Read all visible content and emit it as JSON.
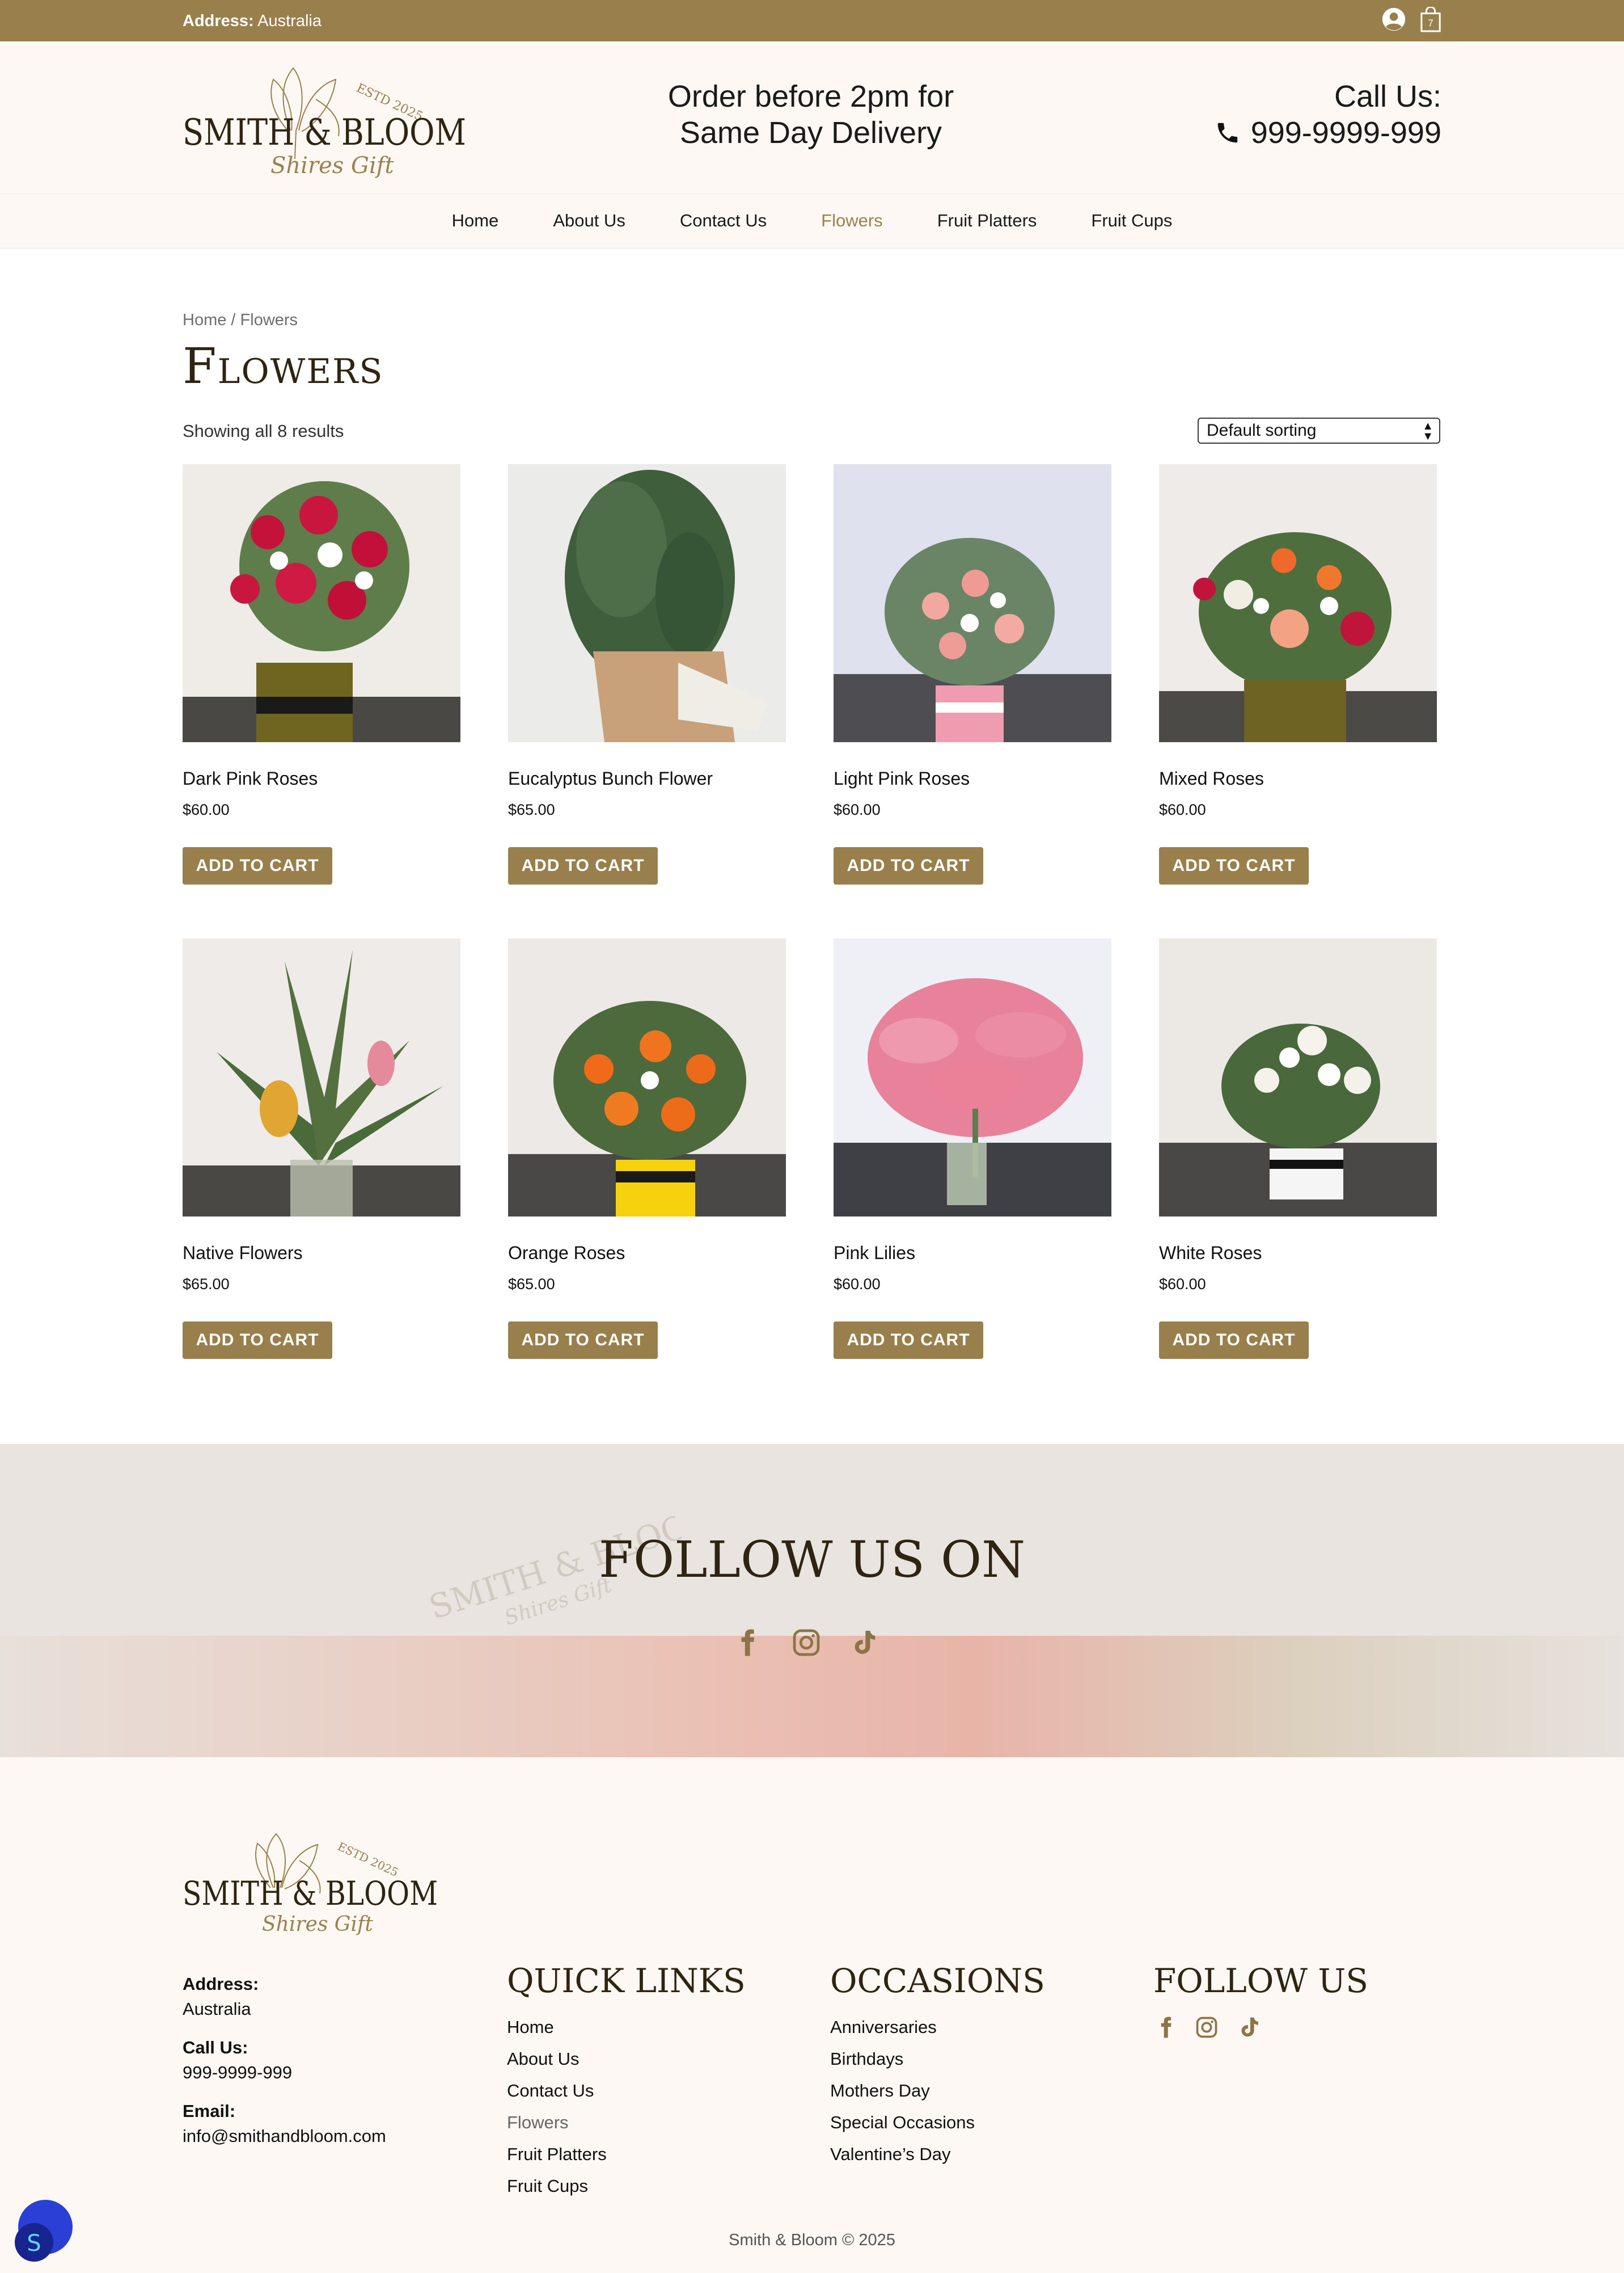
{
  "topbar": {
    "address_label": "Address:",
    "address_value": "Australia",
    "cart_count": "7"
  },
  "header": {
    "logo_brand": "SMITH & BLOOM",
    "logo_script": "Shires Gift",
    "logo_estd": "ESTD 2025",
    "tagline_line1": "Order before 2pm for",
    "tagline_line2": "Same Day Delivery",
    "call_label": "Call Us:",
    "phone": "999-9999-999"
  },
  "nav": {
    "items": [
      {
        "label": "Home"
      },
      {
        "label": "About Us"
      },
      {
        "label": "Contact Us"
      },
      {
        "label": "Flowers"
      },
      {
        "label": "Fruit Platters"
      },
      {
        "label": "Fruit Cups"
      }
    ],
    "active": "Flowers"
  },
  "breadcrumb": {
    "home": "Home",
    "sep": " / ",
    "current": "Flowers"
  },
  "page": {
    "title": "Flowers",
    "result_count": "Showing all 8 results",
    "sort_selected": "Default sorting"
  },
  "products": [
    {
      "name": "Dark Pink Roses",
      "price": "$60.00",
      "button": "ADD TO CART"
    },
    {
      "name": "Eucalyptus Bunch Flower",
      "price": "$65.00",
      "button": "ADD TO CART"
    },
    {
      "name": "Light Pink Roses",
      "price": "$60.00",
      "button": "ADD TO CART"
    },
    {
      "name": "Mixed Roses",
      "price": "$60.00",
      "button": "ADD TO CART"
    },
    {
      "name": "Native Flowers",
      "price": "$65.00",
      "button": "ADD TO CART"
    },
    {
      "name": "Orange Roses",
      "price": "$65.00",
      "button": "ADD TO CART"
    },
    {
      "name": "Pink Lilies",
      "price": "$60.00",
      "button": "ADD TO CART"
    },
    {
      "name": "White Roses",
      "price": "$60.00",
      "button": "ADD TO CART"
    }
  ],
  "follow": {
    "title": "FOLLOW US ON",
    "icons": [
      "facebook-icon",
      "instagram-icon",
      "tiktok-icon"
    ]
  },
  "footer": {
    "address_label": "Address:",
    "address_value": "Australia",
    "call_label": "Call Us:",
    "call_value": "999-9999-999",
    "email_label": "Email:",
    "email_value": "info@smithandbloom.com",
    "quick_links_title": "QUICK LINKS",
    "quick_links": [
      "Home",
      "About Us",
      "Contact Us",
      "Flowers",
      "Fruit Platters",
      "Fruit Cups"
    ],
    "occasions_title": "OCCASIONS",
    "occasions": [
      "Anniversaries",
      "Birthdays",
      "Mothers Day",
      "Special Occasions",
      "Valentine’s Day"
    ],
    "follow_title": "FOLLOW US",
    "copyright": "Smith & Bloom © 2025"
  },
  "colors": {
    "brand": "#987f4b",
    "cream": "#fdf8f4",
    "heading": "#2f2411"
  }
}
